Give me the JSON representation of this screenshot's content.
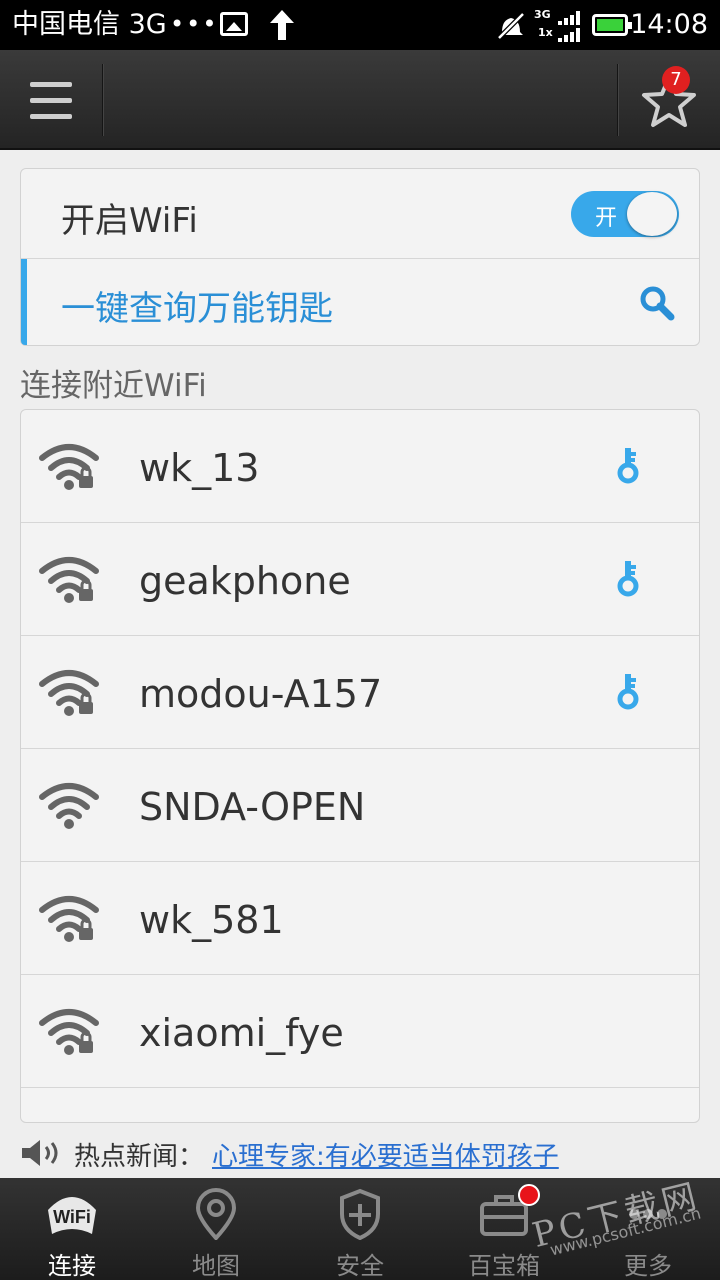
{
  "status_bar": {
    "carrier": "中国电信 3G",
    "dots": "•••",
    "signal_top": "3G",
    "signal_bottom": "1x",
    "time": "14:08"
  },
  "header": {
    "star_badge": "7"
  },
  "wifi_switch": {
    "label": "开启WiFi",
    "toggle_text": "开",
    "enabled": true
  },
  "key_query": {
    "label": "一键查询万能钥匙"
  },
  "nearby": {
    "section_title": "连接附近WiFi",
    "networks": [
      {
        "ssid": "wk_13",
        "locked": true,
        "has_key": true
      },
      {
        "ssid": "geakphone",
        "locked": true,
        "has_key": true
      },
      {
        "ssid": "modou-A157",
        "locked": true,
        "has_key": true
      },
      {
        "ssid": "SNDA-OPEN",
        "locked": false,
        "has_key": false
      },
      {
        "ssid": "wk_581",
        "locked": true,
        "has_key": false
      },
      {
        "ssid": "xiaomi_fye",
        "locked": true,
        "has_key": false
      }
    ]
  },
  "news": {
    "prefix": "热点新闻：",
    "headline": "心理专家:有必要适当体罚孩子"
  },
  "bottom_nav": {
    "items": [
      {
        "label": "连接",
        "icon": "wifi-logo-icon",
        "active": true
      },
      {
        "label": "地图",
        "icon": "map-pin-icon",
        "active": false
      },
      {
        "label": "安全",
        "icon": "shield-icon",
        "active": false
      },
      {
        "label": "百宝箱",
        "icon": "toolbox-icon",
        "active": false
      },
      {
        "label": "更多",
        "icon": "more-icon",
        "active": false
      }
    ]
  },
  "watermark": {
    "text": "PC下载网",
    "url": "www.pcsoft.com.cn"
  },
  "colors": {
    "accent": "#38a8ea",
    "badge": "#e02020",
    "link": "#2a6fd0"
  }
}
